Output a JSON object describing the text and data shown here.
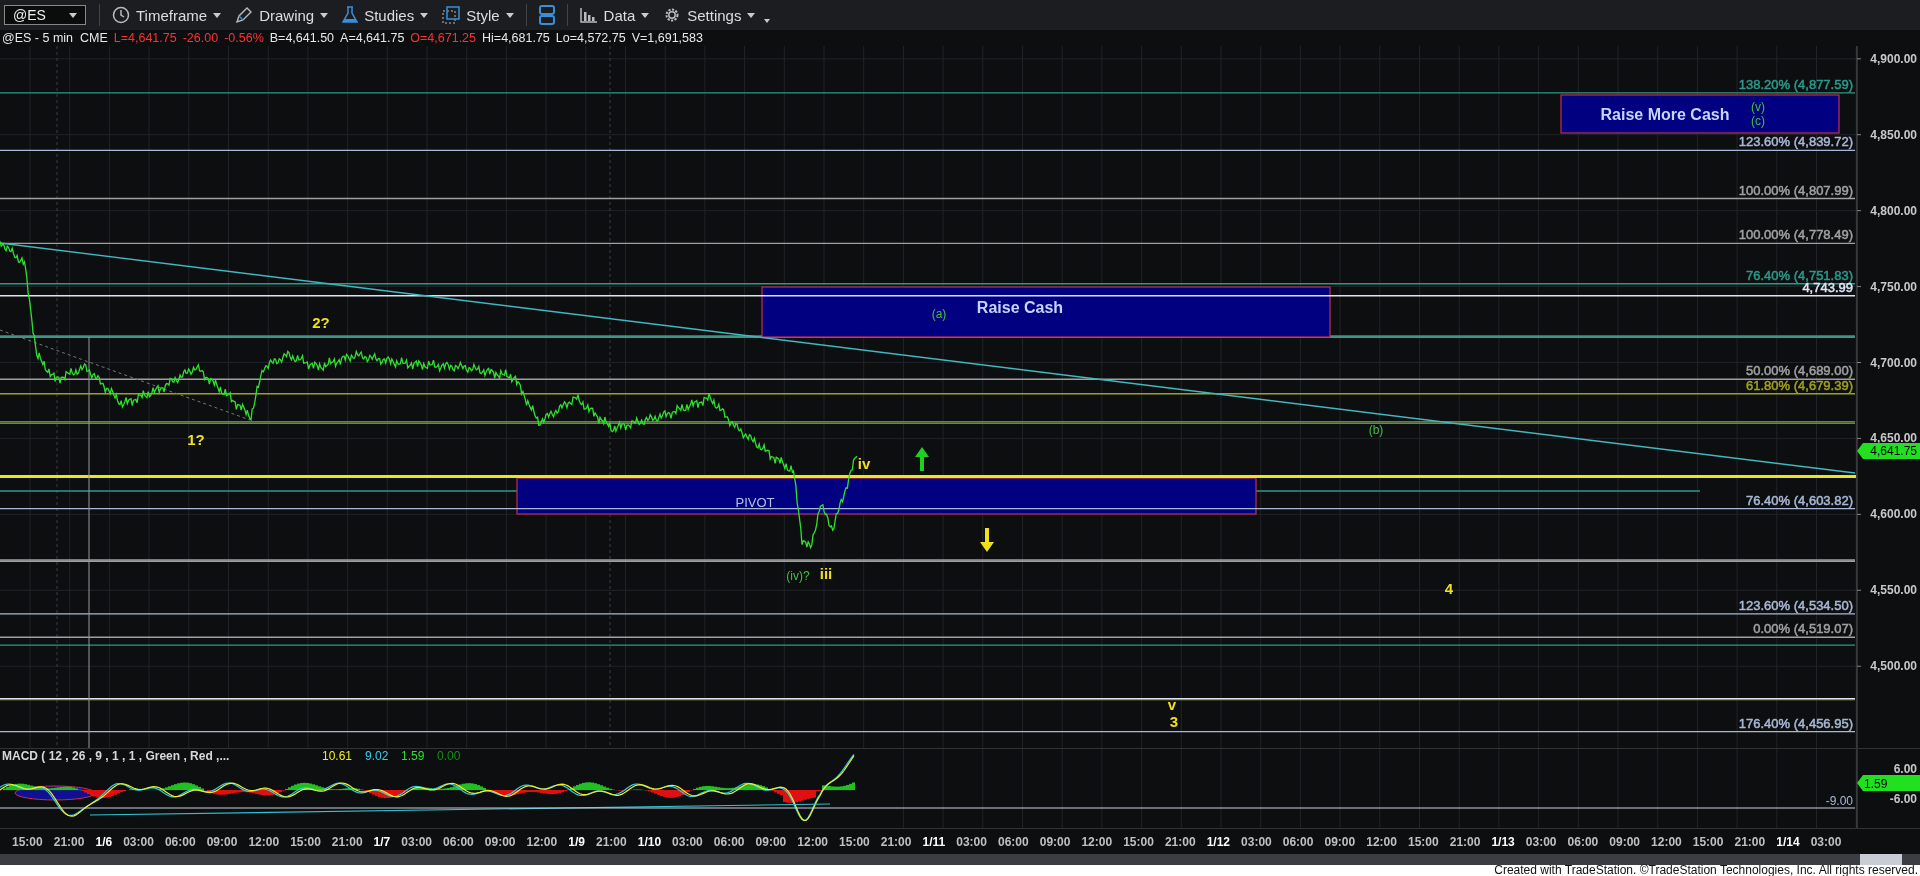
{
  "toolbar": {
    "symbol": "@ES",
    "buttons": [
      {
        "label": "Timeframe",
        "kind": "clock"
      },
      {
        "label": "Drawing",
        "kind": "pen"
      },
      {
        "label": "Studies",
        "kind": "flask"
      },
      {
        "label": "Style",
        "kind": "style"
      },
      {
        "kind": "layout"
      },
      {
        "label": "Data",
        "kind": "bars"
      },
      {
        "label": "Settings",
        "kind": "gear"
      }
    ]
  },
  "quote": [
    {
      "text": "@ES - 5 min  CME",
      "color": "#e8e8e8"
    },
    {
      "text": "L=4,641.75",
      "color": "#ff3030"
    },
    {
      "text": "-26.00",
      "color": "#ff3030"
    },
    {
      "text": "-0.56%",
      "color": "#ff3030"
    },
    {
      "text": "B=4,641.50",
      "color": "#e8e8e8"
    },
    {
      "text": "A=4,641.75",
      "color": "#e8e8e8"
    },
    {
      "text": "O=4,671.25",
      "color": "#ff3030"
    },
    {
      "text": "Hi=4,681.75",
      "color": "#e8e8e8"
    },
    {
      "text": "Lo=4,572.75",
      "color": "#e8e8e8"
    },
    {
      "text": "V=1,691,583",
      "color": "#e8e8e8"
    }
  ],
  "chart": {
    "price_ticks": [
      "4,900.00",
      "4,850.00",
      "4,800.00",
      "4,750.00",
      "4,700.00",
      "4,650.00",
      "4,600.00",
      "4,550.00",
      "4,500.00"
    ],
    "last_price": "4,641.75",
    "levels": [
      {
        "label": "138.20% (4,877.59)",
        "color": "#2a9a8a"
      },
      {
        "label": "123.60% (4,839.72)",
        "color": "#a8b8d4"
      },
      {
        "label": "100.00% (4,807.99)",
        "color": "#a0a0a0"
      },
      {
        "label": "100.00% (4,778.49)",
        "color": "#a0a0a0"
      },
      {
        "label": "76.40% (4,751.83)",
        "color": "#2a9a8a"
      },
      {
        "label": "4,743.99",
        "color": "#dce4f4"
      },
      {
        "label": "50.00% (4,689.00)",
        "color": "#a0a0a0"
      },
      {
        "label": "61.80% (4,679.39)",
        "color": "#a0a020"
      },
      {
        "label": "76.40% (4,603.82)",
        "color": "#a8b8d4"
      },
      {
        "label": "123.60% (4,534.50)",
        "color": "#a8b8d4"
      },
      {
        "label": "0.00% (4,519.07)",
        "color": "#a0a0a0"
      },
      {
        "label": "176.40% (4,456.95)",
        "color": "#a8b8d4"
      }
    ],
    "zones": [
      {
        "label": "Raise More Cash"
      },
      {
        "label": "Raise Cash"
      },
      {
        "label": "PIVOT"
      }
    ],
    "wave_labels": [
      {
        "text": "(v)",
        "color": "#40c040"
      },
      {
        "text": "(c)",
        "color": "#40c040"
      },
      {
        "text": "2?",
        "color": "#f0e020"
      },
      {
        "text": "(a)",
        "color": "#40c040"
      },
      {
        "text": "1?",
        "color": "#f0e020"
      },
      {
        "text": "(b)",
        "color": "#40c040"
      },
      {
        "text": "iv",
        "color": "#f0e020"
      },
      {
        "text": "(iv)?",
        "color": "#40c040"
      },
      {
        "text": "iii",
        "color": "#f0e020"
      },
      {
        "text": "4",
        "color": "#f0e020"
      },
      {
        "text": "v",
        "color": "#f0e020"
      },
      {
        "text": "3",
        "color": "#f0e020"
      }
    ],
    "arrows": [
      {
        "kind": "up",
        "color": "#20d020"
      },
      {
        "kind": "down",
        "color": "#f0e020"
      }
    ]
  },
  "macd": {
    "title": "MACD ( 12 , 26 , 9 , 1 , 1 , Green , Red ,...",
    "values": [
      {
        "text": "10.61",
        "color": "#f0f020"
      },
      {
        "text": "9.02",
        "color": "#30d0f0"
      },
      {
        "text": "1.59",
        "color": "#30e030"
      },
      {
        "text": "0.00",
        "color": "#109010"
      }
    ],
    "ticks": [
      "6.00",
      "-6.00"
    ],
    "reference": "-9.00",
    "last_value": "1.59"
  },
  "time_axis": [
    {
      "text": "15:00",
      "kind": "time"
    },
    {
      "text": "21:00",
      "kind": "time"
    },
    {
      "text": "1/6",
      "kind": "date"
    },
    {
      "text": "03:00",
      "kind": "time"
    },
    {
      "text": "06:00",
      "kind": "time"
    },
    {
      "text": "09:00",
      "kind": "time"
    },
    {
      "text": "12:00",
      "kind": "time"
    },
    {
      "text": "15:00",
      "kind": "time"
    },
    {
      "text": "21:00",
      "kind": "time"
    },
    {
      "text": "1/7",
      "kind": "date"
    },
    {
      "text": "03:00",
      "kind": "time"
    },
    {
      "text": "06:00",
      "kind": "time"
    },
    {
      "text": "09:00",
      "kind": "time"
    },
    {
      "text": "12:00",
      "kind": "time"
    },
    {
      "text": "1/9",
      "kind": "date"
    },
    {
      "text": "21:00",
      "kind": "time"
    },
    {
      "text": "1/10",
      "kind": "date"
    },
    {
      "text": "03:00",
      "kind": "time"
    },
    {
      "text": "06:00",
      "kind": "time"
    },
    {
      "text": "09:00",
      "kind": "time"
    },
    {
      "text": "12:00",
      "kind": "time"
    },
    {
      "text": "15:00",
      "kind": "time"
    },
    {
      "text": "21:00",
      "kind": "time"
    },
    {
      "text": "1/11",
      "kind": "date"
    },
    {
      "text": "03:00",
      "kind": "time"
    },
    {
      "text": "06:00",
      "kind": "time"
    },
    {
      "text": "09:00",
      "kind": "time"
    },
    {
      "text": "12:00",
      "kind": "time"
    },
    {
      "text": "15:00",
      "kind": "time"
    },
    {
      "text": "21:00",
      "kind": "time"
    },
    {
      "text": "1/12",
      "kind": "date"
    },
    {
      "text": "03:00",
      "kind": "time"
    },
    {
      "text": "06:00",
      "kind": "time"
    },
    {
      "text": "09:00",
      "kind": "time"
    },
    {
      "text": "12:00",
      "kind": "time"
    },
    {
      "text": "15:00",
      "kind": "time"
    },
    {
      "text": "21:00",
      "kind": "time"
    },
    {
      "text": "1/13",
      "kind": "date"
    },
    {
      "text": "03:00",
      "kind": "time"
    },
    {
      "text": "06:00",
      "kind": "time"
    },
    {
      "text": "09:00",
      "kind": "time"
    },
    {
      "text": "12:00",
      "kind": "time"
    },
    {
      "text": "15:00",
      "kind": "time"
    },
    {
      "text": "21:00",
      "kind": "time"
    },
    {
      "text": "1/14",
      "kind": "date"
    },
    {
      "text": "03:00",
      "kind": "time"
    }
  ],
  "footer": "Created with TradeStation. ©TradeStation Technologies, Inc. All rights reserved."
}
